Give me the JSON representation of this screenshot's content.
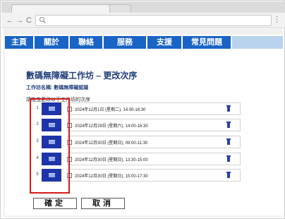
{
  "browser": {
    "back_icon": "arrow-left-icon",
    "forward_icon": "arrow-right-icon",
    "reload_icon": "reload-icon",
    "page_icon": "page-icon",
    "menu_icon": "vertical-dots-icon",
    "back_glyph": "←",
    "forward_glyph": "→",
    "reload_glyph": "C",
    "menu_glyph": "⋮"
  },
  "nav": {
    "items": [
      "主頁",
      "關於",
      "聯絡",
      "服務",
      "支援",
      "常見問題"
    ],
    "color": "#1a64c6"
  },
  "page": {
    "title": "數碼無障礙工作坊 – 更改次序",
    "workshop_name": "工作坊名稱: 數碼無障礙認識",
    "instruction": "請拖曳更改以下工作坊的次序"
  },
  "sessions": [
    {
      "num": "1",
      "datetime": "2024年12月1日 (星期二), 14:00-16:30"
    },
    {
      "num": "2",
      "datetime": "2024年12月29日 (星期六), 14:00-16:30"
    },
    {
      "num": "3",
      "datetime": "2024年12月30日 (星期日), 09:00-11:30"
    },
    {
      "num": "4",
      "datetime": "2024年12月30日 (星期日), 13:30-15:00"
    },
    {
      "num": "5",
      "datetime": "2024年12月30日 (星期日), 15:00-17:30"
    }
  ],
  "buttons": {
    "confirm": "確定",
    "cancel": "取消"
  },
  "colors": {
    "handle": "#1d35a8",
    "highlight": "#d31b1b",
    "title": "#1f3d7a"
  }
}
